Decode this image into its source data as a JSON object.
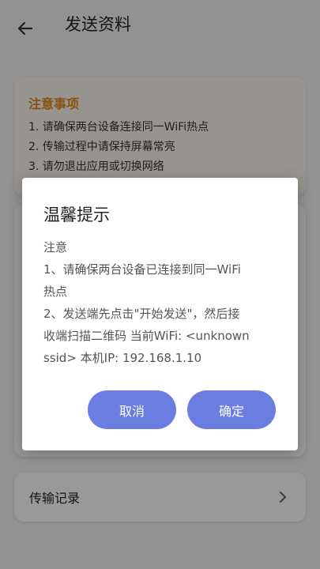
{
  "header": {
    "title": "发送资料",
    "back_icon": "arrow-left-icon"
  },
  "notice": {
    "title": "注意事项",
    "items": [
      "1. 请确保两台设备连接同一WiFi热点",
      "2. 传输过程中请保持屏幕常亮",
      "3. 请勿退出应用或切换网络"
    ]
  },
  "record": {
    "label": "传输记录",
    "chevron_icon": "chevron-right-icon"
  },
  "dialog": {
    "title": "温馨提示",
    "body_lines": [
      "注意",
      "1、请确保两台设备已连接到同一WiFi",
      "热点",
      "2、发送端先点击\"开始发送\"，然后接",
      "收端扫描二维码 当前WiFi: <unknown",
      "ssid> 本机IP: 192.168.1.10"
    ],
    "cancel_label": "取消",
    "ok_label": "确定"
  },
  "colors": {
    "accent": "#6b7de0",
    "notice_title": "#e08a1c",
    "overlay": "rgba(0,0,0,0.4)"
  }
}
